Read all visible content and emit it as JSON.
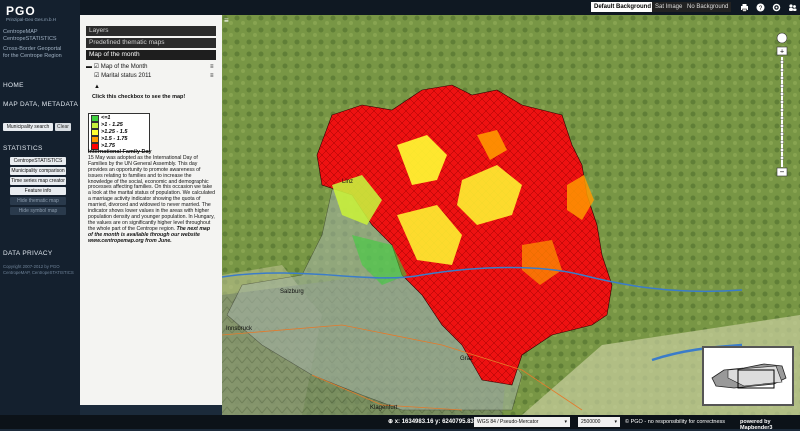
{
  "app": {
    "logo": "PGO",
    "logo_sub": "Prinzipal-Geo Ges.m.b.H",
    "project_lines": [
      "CentropeMAP",
      "CentropeSTATISTICS"
    ],
    "tagline_lines": [
      "Cross-Border Geoportal",
      "for the Centrope Region"
    ]
  },
  "leftnav": {
    "home": "HOME",
    "map_data": "MAP DATA, METADATA",
    "municipality_search": "Municipality search",
    "clear": "Clear",
    "statistics": "STATISTICS",
    "buttons": [
      "CentropeSTATISTICS",
      "Municipality comparison",
      "Time series map creator",
      "Feature info",
      "Hide thematic map",
      "Hide symbol map"
    ],
    "data_privacy": "DATA PRIVACY",
    "copyright_lines": [
      "Copyright 2007-2012 by PGO",
      "CentropeMAP, CentropeSTATISTICS"
    ]
  },
  "topbar": {
    "default_bg": "Default Background",
    "sat_image": "Sat Image",
    "no_bg": "No Background",
    "icons": [
      "print-icon",
      "help-icon",
      "settings-icon",
      "users-icon"
    ]
  },
  "panel": {
    "tabs": [
      "Layers",
      "Predefined thematic maps",
      "Map of the month"
    ],
    "map_of_month_label": "Map of the Month",
    "layer_label": "Marital status 2011",
    "hint": "Click this checkbox to see the map!",
    "legend": [
      {
        "label": "<=1",
        "color": "#3ecf3e"
      },
      {
        "label": ">1 - 1.25",
        "color": "#c8f03c"
      },
      {
        "label": ">1.25 - 1.5",
        "color": "#ffff33"
      },
      {
        "label": ">1.5 - 1.75",
        "color": "#ff9900"
      },
      {
        "label": ">1.75",
        "color": "#ff0000"
      }
    ],
    "desc_title": "International Family Day",
    "desc_body": "15 May was adopted as the International Day of Families by the UN General Assembly. This day provides an opportunity to promote awareness of issues relating to families and to increase the knowledge of the social, economic and demographic processes affecting families. On this occasion we take a look at the marital status of population. We calculated a marriage activity indicator showing the quota of married, divorced and widowed to never married. The indicator shows lower values in the areas with higher population density and younger population. In Hungary, the values are on significantly higher level throughout the whole part of the Centrope region.",
    "desc_italic": "The next map of the month is available through our website www.centropemap.org from June."
  },
  "map": {
    "city_labels": [
      "Salzburg",
      "Innsbruck",
      "Klagenfurt",
      "Graz",
      "Linz"
    ]
  },
  "footer": {
    "coords": "x: 1634983.16 y: 6240795.83",
    "projection": "WGS 84 / Pseudo-Mercator",
    "scale": "2500000",
    "notice": "© PGO - no responsibility for correctness",
    "powered": "powered by Mapbender3"
  },
  "colors": {
    "red": "#ee1111",
    "orange": "#ff9900",
    "yellow": "#ffff33",
    "lightgreen": "#c8f03c",
    "green": "#3ecf3e"
  }
}
